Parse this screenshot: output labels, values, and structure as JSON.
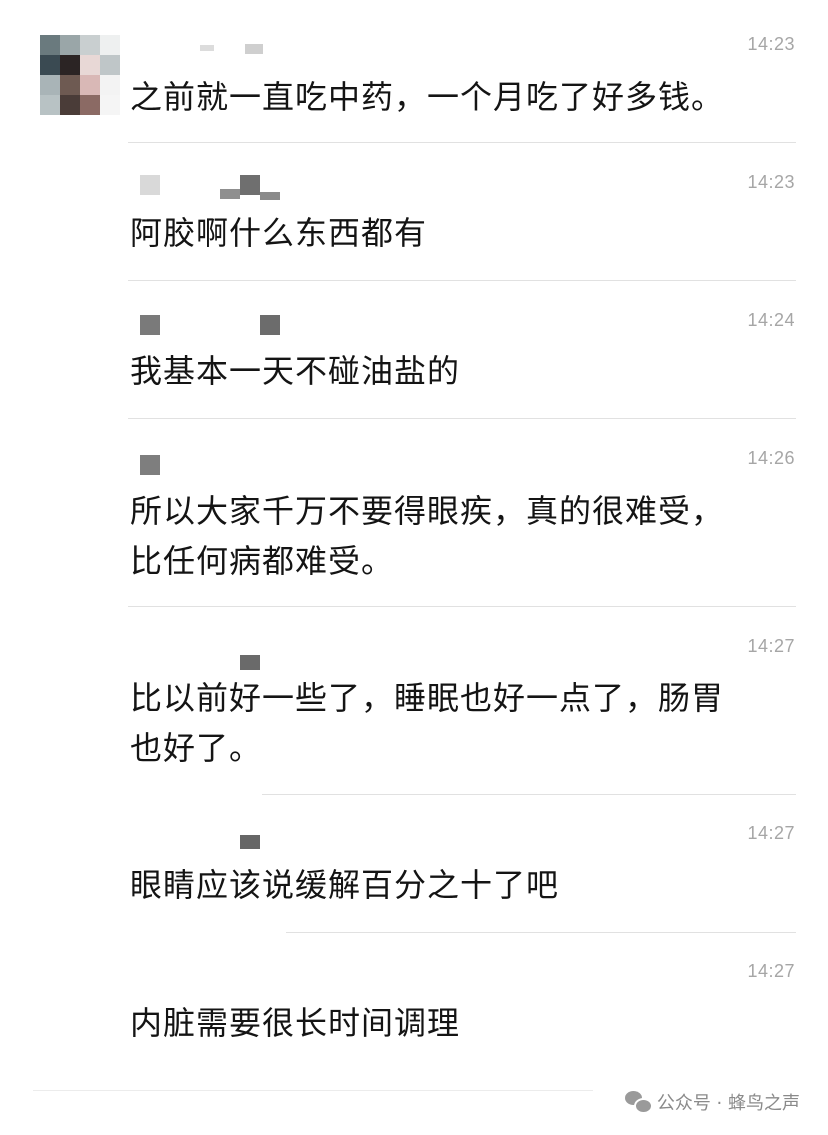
{
  "messages": [
    {
      "time": "14:23",
      "lines": [
        "之前就一直吃中药，一个月吃了好多钱。"
      ]
    },
    {
      "time": "14:23",
      "lines": [
        "阿胶啊什么东西都有"
      ]
    },
    {
      "time": "14:24",
      "lines": [
        "我基本一天不碰油盐的"
      ]
    },
    {
      "time": "14:26",
      "lines": [
        "所以大家千万不要得眼疾，真的很难受，",
        "比任何病都难受。"
      ]
    },
    {
      "time": "14:27",
      "lines": [
        "比以前好一些了，睡眠也好一点了，肠胃",
        "也好了。"
      ]
    },
    {
      "time": "14:27",
      "lines": [
        "眼睛应该说缓解百分之十了吧"
      ]
    },
    {
      "time": "14:27",
      "lines": [
        "内脏需要很长时间调理"
      ]
    }
  ],
  "footer": {
    "text": "公众号 · 蜂鸟之声",
    "icon": "wechat-icon"
  },
  "avatar": {
    "icon": "blurred-avatar-icon",
    "colors": [
      "#6a7a7e",
      "#9aa6a8",
      "#c9cfd0",
      "#eef0f0",
      "#3a4a52",
      "#2b2424",
      "#e8d8d6",
      "#bfc6c8",
      "#a9b4b7",
      "#6e5a52",
      "#d9b8b6",
      "#f3f3f3",
      "#b8c2c4",
      "#4a3c38",
      "#8b6a64",
      "#f5f5f5"
    ]
  }
}
